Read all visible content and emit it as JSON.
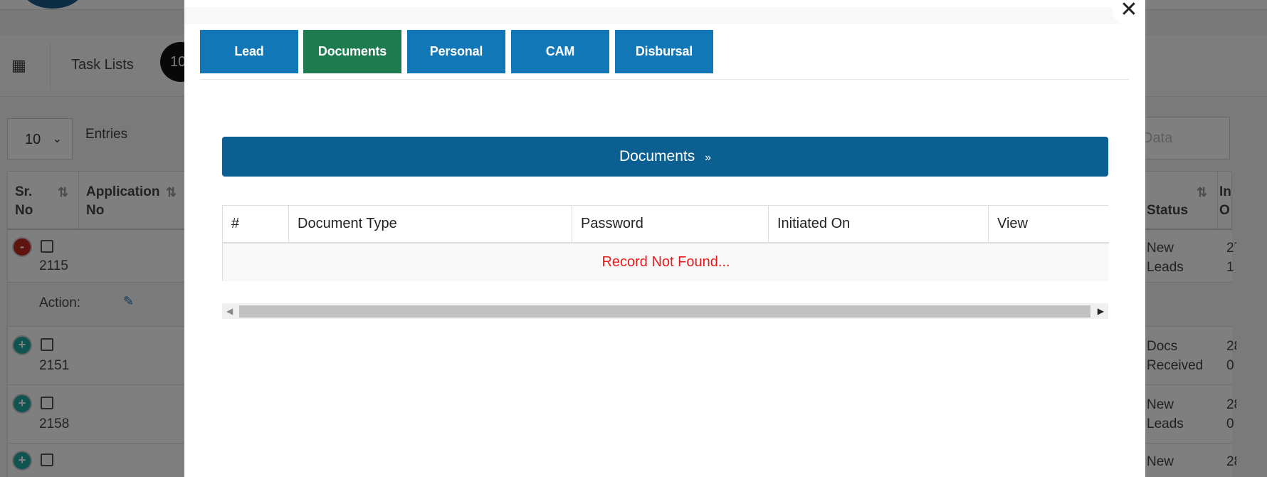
{
  "background": {
    "header": {
      "menu_icon": "grid-icon",
      "task_lists_label": "Task Lists",
      "task_count": "10"
    },
    "entries": {
      "value": "10",
      "label": "Entries"
    },
    "search_placeholder": "Data",
    "table_headers": [
      "Sr. No",
      "Application No",
      "Status",
      "In O"
    ],
    "rows": [
      {
        "toggle": "-",
        "id": "2115",
        "status": "New Leads",
        "date": "27 1"
      },
      {
        "action_label": "Action:"
      },
      {
        "toggle": "+",
        "id": "2151",
        "status": "Docs Received",
        "date": "28 0"
      },
      {
        "toggle": "+",
        "id": "2158",
        "status": "New Leads",
        "date": "28 0"
      },
      {
        "toggle": "+",
        "id": "",
        "status": "New",
        "date": "28"
      }
    ]
  },
  "modal": {
    "close_symbol": "✕",
    "tabs": [
      {
        "label": "Lead",
        "active": false
      },
      {
        "label": "Documents",
        "active": true
      },
      {
        "label": "Personal",
        "active": false
      },
      {
        "label": "CAM",
        "active": false
      },
      {
        "label": "Disbursal",
        "active": false
      }
    ],
    "section_title": "Documents",
    "section_icon": "double-chevron-down-icon",
    "document_table": {
      "columns": [
        "#",
        "Document Type",
        "Password",
        "Initiated On",
        "View"
      ],
      "empty_message": "Record Not Found..."
    }
  },
  "colors": {
    "tab_blue": "#1277b6",
    "tab_active_green": "#1e7b4f",
    "section_header": "#0b5f91",
    "empty_text_red": "#e51c1c"
  }
}
